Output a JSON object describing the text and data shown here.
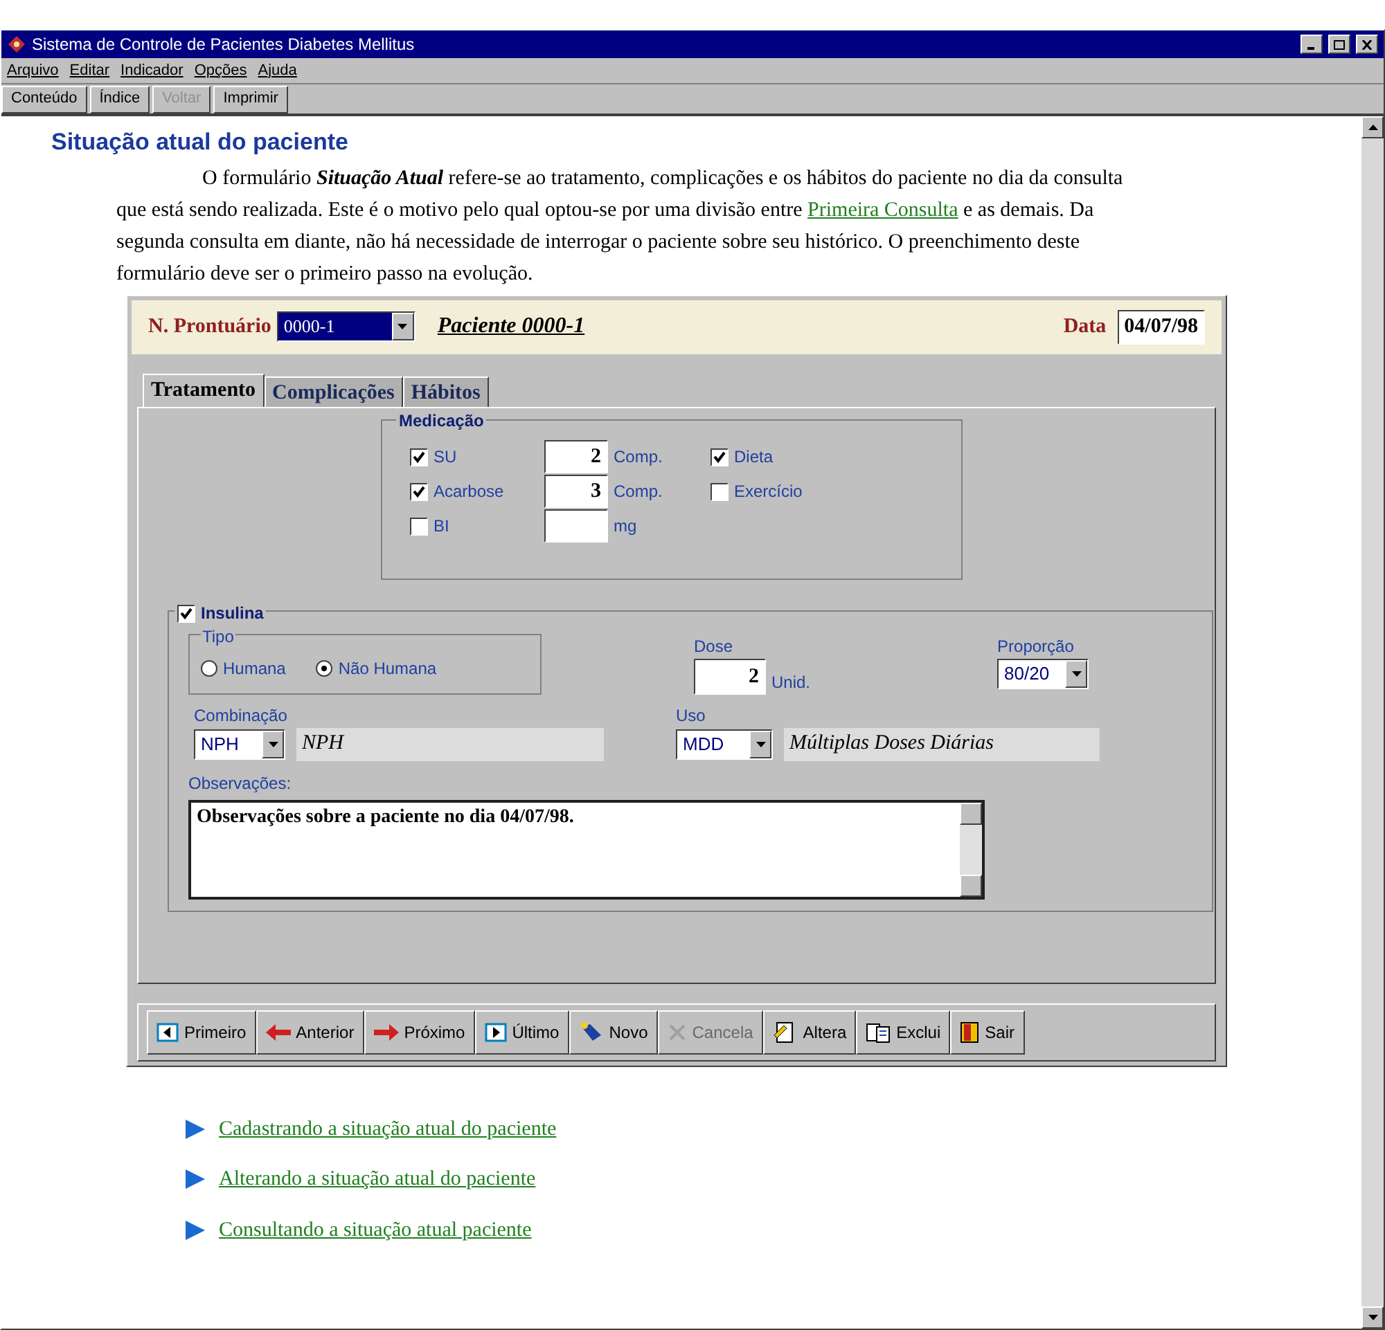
{
  "window": {
    "title": "Sistema de Controle de Pacientes Diabetes Mellitus"
  },
  "menu": [
    "Arquivo",
    "Editar",
    "Indicador",
    "Opções",
    "Ajuda"
  ],
  "toolbar": [
    {
      "label": "Conteúdo",
      "disabled": false
    },
    {
      "label": "Índice",
      "disabled": false
    },
    {
      "label": "Voltar",
      "disabled": true
    },
    {
      "label": "Imprimir",
      "disabled": false
    }
  ],
  "heading": "Situação atual do paciente",
  "intro": {
    "before": "O formulário **Situação Atual** refere-se ao tratamento, complicações e os hábitos do paciente no dia da consulta que está sendo realizada.  Este é o motivo pelo qual optou-se por uma divisão entre ",
    "link": "Primeira Consulta",
    "after": " e as demais.  Da segunda consulta em diante, não há necessidade de interrogar o paciente sobre seu histórico. O preenchimento deste formulário deve ser o primeiro passo na evolução."
  },
  "form": {
    "record_label": "N. Prontuário",
    "record_value": "0000-1",
    "patient": "Paciente 0000-1",
    "date_label": "Data",
    "date": "04/07/98",
    "tabs": [
      {
        "label": "Tratamento",
        "selected": true
      },
      {
        "label": "Complicações",
        "selected": false
      },
      {
        "label": "Hábitos",
        "selected": false
      }
    ],
    "medication": {
      "title": "Medicação",
      "drugs": [
        {
          "label": "SU",
          "checked": true,
          "quantity": "2",
          "unit": "Comp."
        },
        {
          "label": "Acarbose",
          "checked": true,
          "quantity": "3",
          "unit": "Comp."
        },
        {
          "label": "BI",
          "checked": false,
          "unit": "mg"
        }
      ],
      "habits": [
        {
          "label": "Dieta",
          "checked": true
        },
        {
          "label": "Exercício",
          "checked": false
        }
      ]
    },
    "insulin": {
      "label": "Insulina",
      "checked": true,
      "type_title": "Tipo",
      "types": [
        {
          "label": "Humana",
          "selected": false
        },
        {
          "label": "Não Humana",
          "selected": true
        }
      ],
      "dose_label": "Dose",
      "dose": "2",
      "dose_unit": "Unid.",
      "ratio_label": "Proporção",
      "ratio": "80/20",
      "combination_label": "Combinação",
      "combination": "NPH",
      "combination_name": "NPH",
      "use_label": "Uso",
      "use": "MDD",
      "use_name": "Múltiplas Doses Diárias",
      "notes_label": "Observações:",
      "notes": "Observações sobre a paciente no dia 04/07/98."
    },
    "buttons": [
      {
        "label": "Primeiro",
        "kind": "first",
        "disabled": false
      },
      {
        "label": "Anterior",
        "kind": "prev",
        "disabled": false
      },
      {
        "label": "Próximo",
        "kind": "next",
        "disabled": false
      },
      {
        "label": "Último",
        "kind": "last",
        "disabled": false
      },
      {
        "label": "Novo",
        "kind": "new",
        "disabled": false
      },
      {
        "label": "Cancela",
        "kind": "cancel",
        "disabled": true
      },
      {
        "label": "Altera",
        "kind": "edit",
        "disabled": false
      },
      {
        "label": "Exclui",
        "kind": "delete",
        "disabled": false
      },
      {
        "label": "Sair",
        "kind": "exit",
        "disabled": false
      }
    ]
  },
  "links": [
    "Cadastrando a situação atual do paciente",
    "Alterando a situação atual do paciente",
    "Consultando a situação atual paciente"
  ]
}
